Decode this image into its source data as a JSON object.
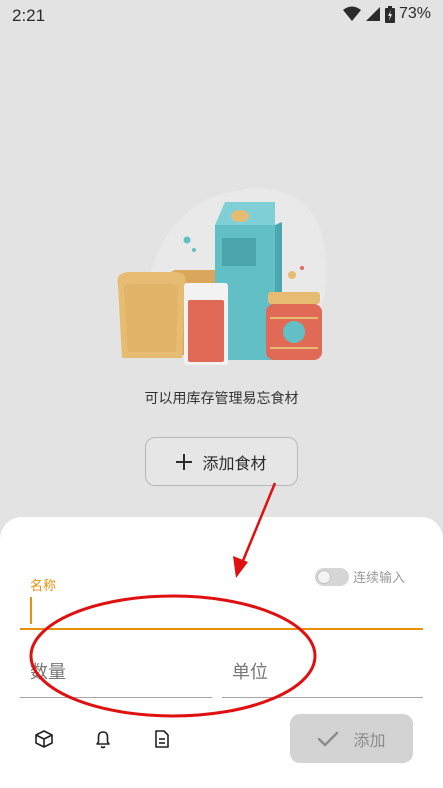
{
  "status_bar": {
    "time": "2:21",
    "battery": "73%"
  },
  "empty_state": {
    "message": "可以用库存管理易忘食材"
  },
  "add_food_button": {
    "label": "添加食材"
  },
  "form": {
    "name_label": "名称",
    "continuous_label": "连续输入",
    "quantity_placeholder": "数量",
    "unit_placeholder": "单位",
    "submit_label": "添加"
  },
  "colors": {
    "accent": "#e8900c",
    "annotation": "#e01010"
  }
}
